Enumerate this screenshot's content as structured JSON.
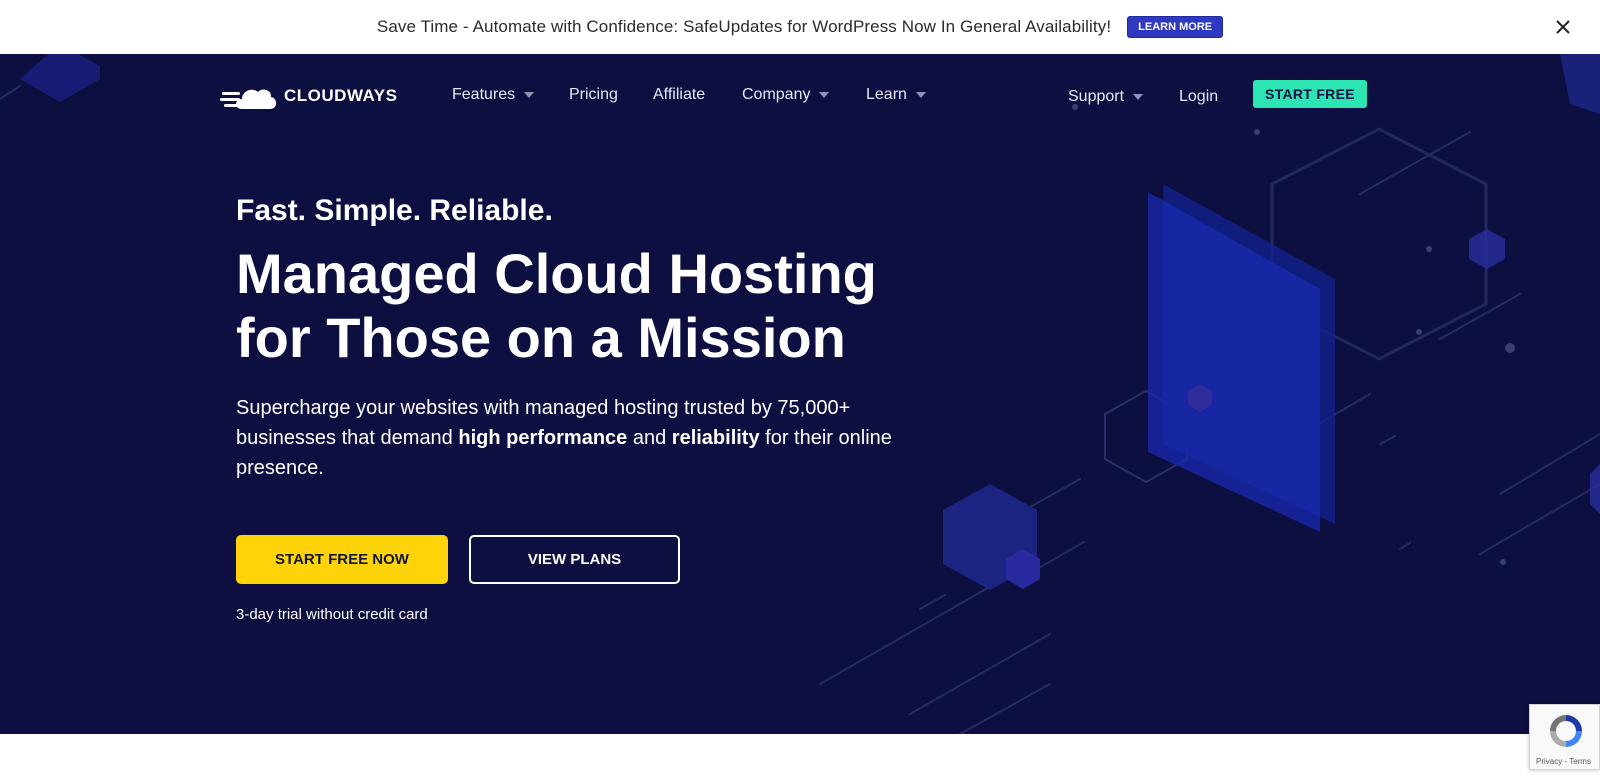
{
  "announcement": {
    "text": "Save Time - Automate with Confidence: SafeUpdates for WordPress Now In General Availability!",
    "button_label": "LEARN MORE"
  },
  "nav": {
    "logo_text": "CLOUDWAYS",
    "links": [
      {
        "label": "Features",
        "has_dropdown": true
      },
      {
        "label": "Pricing",
        "has_dropdown": false
      },
      {
        "label": "Affiliate",
        "has_dropdown": false
      },
      {
        "label": "Company",
        "has_dropdown": true
      },
      {
        "label": "Learn",
        "has_dropdown": true
      }
    ],
    "support_label": "Support",
    "login_label": "Login",
    "cta_label": "START FREE"
  },
  "hero": {
    "tagline": "Fast. Simple. Reliable.",
    "headline_line1": "Managed Cloud Hosting",
    "headline_line2": "for Those on a Mission",
    "sub_part1": "Supercharge your websites with managed hosting trusted by 75,000+ businesses that demand ",
    "sub_bold1": "high performance",
    "sub_part2": " and ",
    "sub_bold2": "reliability",
    "sub_part3": " for their online presence.",
    "primary_button": "START FREE NOW",
    "secondary_button": "VIEW PLANS",
    "trial_note": "3-day trial without credit card"
  },
  "recaptcha": {
    "links": "Privacy - Terms"
  },
  "colors": {
    "hero_bg": "#0c0f3f",
    "cta_green": "#2ce5b2",
    "primary_yellow": "#ffd30a",
    "announce_button": "#2f39bf"
  }
}
